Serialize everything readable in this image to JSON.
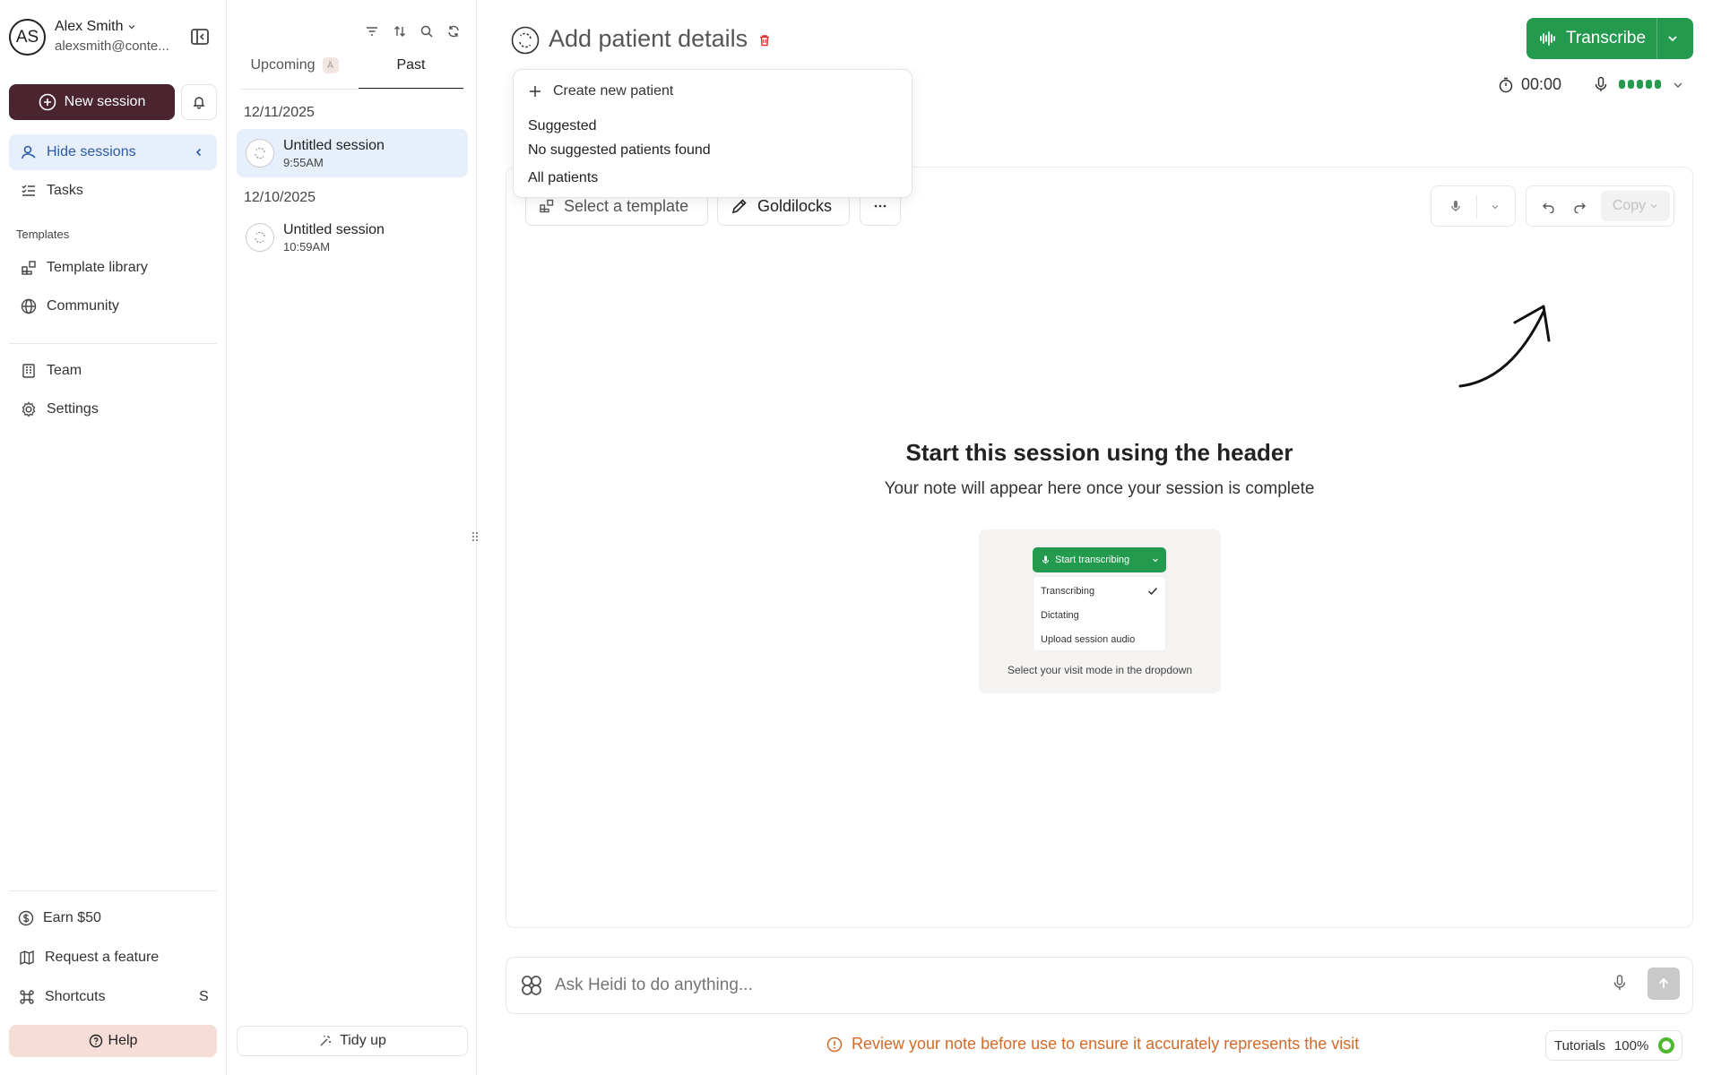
{
  "user": {
    "initials": "AS",
    "name": "Alex Smith",
    "email": "alexsmith@conte..."
  },
  "sidebar": {
    "new_session": "New session",
    "hide_sessions": "Hide sessions",
    "tasks": "Tasks",
    "templates_heading": "Templates",
    "template_library": "Template library",
    "community": "Community",
    "team": "Team",
    "settings": "Settings",
    "earn": "Earn $50",
    "request_feature": "Request a feature",
    "shortcuts": "Shortcuts",
    "shortcuts_key": "S",
    "help": "Help"
  },
  "sessions": {
    "tabs": {
      "upcoming": "Upcoming",
      "upcoming_badge": "Ä",
      "past": "Past"
    },
    "groups": [
      {
        "date": "12/11/2025",
        "items": [
          {
            "title": "Untitled session",
            "time": "9:55AM"
          }
        ]
      },
      {
        "date": "12/10/2025",
        "items": [
          {
            "title": "Untitled session",
            "time": "10:59AM"
          }
        ]
      }
    ],
    "tidy_up": "Tidy up"
  },
  "main": {
    "title": "Add patient details",
    "transcribe": "Transcribe",
    "timer": "00:00",
    "select_template": "Select a template",
    "goldilocks": "Goldilocks",
    "copy": "Copy",
    "empty_title": "Start this session using the header",
    "empty_sub": "Your note will appear here once your session is complete",
    "illus": {
      "button": "Start transcribing",
      "options": [
        "Transcribing",
        "Dictating",
        "Upload session audio"
      ],
      "caption": "Select your visit mode in the dropdown"
    },
    "ask_placeholder": "Ask Heidi to do anything...",
    "review": "Review your note before use to ensure it accurately represents the visit",
    "tutorials": "Tutorials",
    "progress": "100%"
  },
  "dropdown": {
    "create": "Create new patient",
    "suggested": "Suggested",
    "none_found": "No suggested patients found",
    "all": "All patients"
  },
  "colors": {
    "brand": "#4a2530",
    "accent_green": "#239a4e",
    "active_bg": "#e6effa",
    "warning": "#d46a2a"
  }
}
